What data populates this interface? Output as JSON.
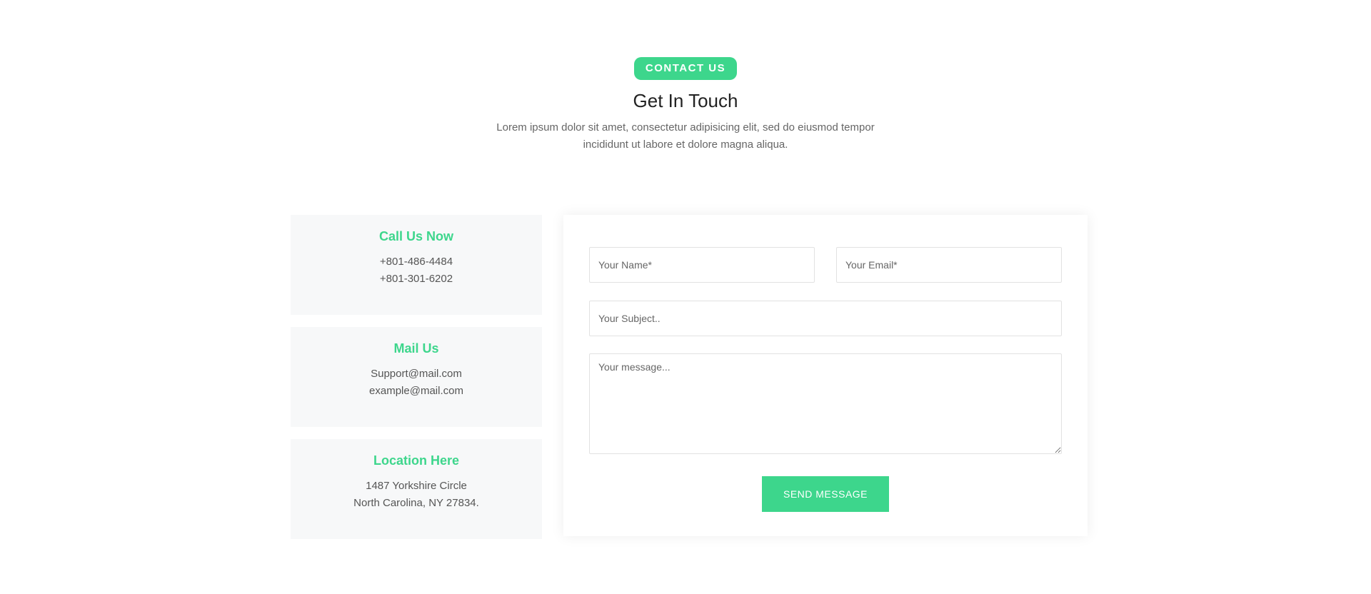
{
  "header": {
    "badge": "CONTACT US",
    "title": "Get In Touch",
    "subtitle": "Lorem ipsum dolor sit amet, consectetur adipisicing elit, sed do eiusmod tempor incididunt ut labore et dolore magna aliqua."
  },
  "info": {
    "call": {
      "title": "Call Us Now",
      "lines": [
        "+801-486-4484",
        "+801-301-6202"
      ]
    },
    "mail": {
      "title": "Mail Us",
      "lines": [
        "Support@mail.com",
        "example@mail.com"
      ]
    },
    "location": {
      "title": "Location Here",
      "lines": [
        "1487 Yorkshire Circle",
        "North Carolina, NY 27834."
      ]
    }
  },
  "form": {
    "name_placeholder": "Your Name*",
    "name_value": "",
    "email_placeholder": "Your Email*",
    "email_value": "",
    "subject_placeholder": "Your Subject..",
    "subject_value": "",
    "message_placeholder": "Your message...",
    "message_value": "",
    "submit_label": "SEND MESSAGE"
  },
  "colors": {
    "accent": "#3dd68c",
    "card_bg": "#f7f8f9",
    "heading": "#222222",
    "body_text": "#666666"
  }
}
